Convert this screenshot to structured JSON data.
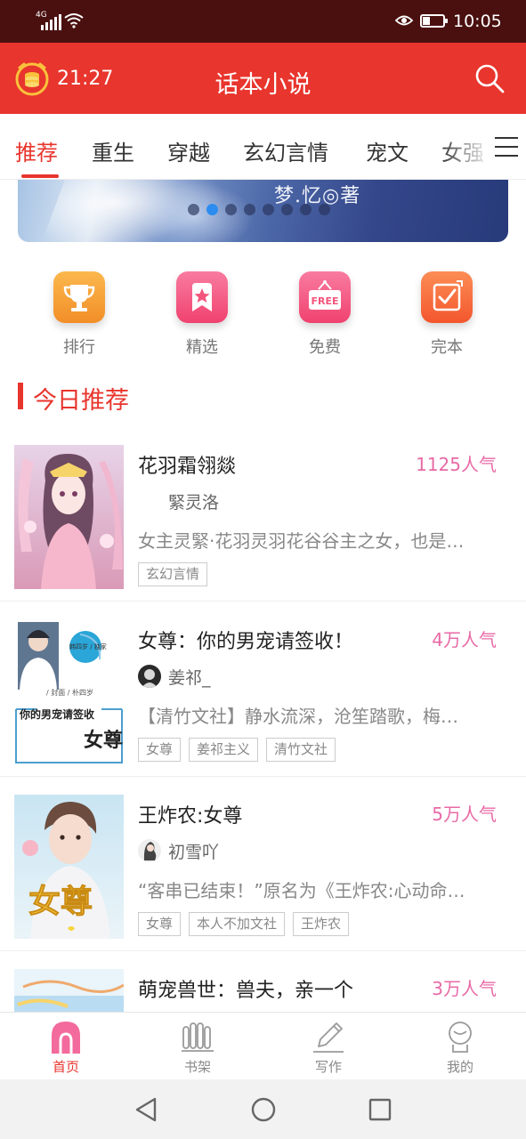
{
  "status_bar": {
    "network": "4G",
    "time": "10:05"
  },
  "header": {
    "timer": "21:27",
    "title": "话本小说",
    "icons": [
      "coin-timer-icon",
      "search-icon"
    ]
  },
  "tabs": [
    {
      "label": "推荐",
      "active": true
    },
    {
      "label": "重生",
      "active": false
    },
    {
      "label": "穿越",
      "active": false
    },
    {
      "label": "玄幻言情",
      "active": false
    },
    {
      "label": "宠文",
      "active": false
    },
    {
      "label": "女强",
      "active": false
    }
  ],
  "banner": {
    "caption": "梦.忆◎著",
    "slide_count": 8,
    "active_slide": 1
  },
  "quick_actions": [
    {
      "label": "排行",
      "icon": "trophy-icon",
      "color": "#f5a33a"
    },
    {
      "label": "精选",
      "icon": "star-icon",
      "color": "#f4547c"
    },
    {
      "label": "免费",
      "icon": "free-sign-icon",
      "color": "#f4547c",
      "icon_text": "FREE"
    },
    {
      "label": "完本",
      "icon": "check-icon",
      "color": "#f86a3c"
    }
  ],
  "section": {
    "title": "今日推荐"
  },
  "books": [
    {
      "title": "花羽霜翎燚",
      "popularity": "1125人气",
      "author": "緊灵洛",
      "description": "女主灵緊·花羽灵羽花谷谷主之女，也是…",
      "tags": [
        "玄幻言情"
      ]
    },
    {
      "title": "女尊：你的男宠请签收！",
      "popularity": "4万人气",
      "author": "姜祁_",
      "description": "【清竹文社】静水流深，沧笙踏歌，梅…",
      "tags": [
        "女尊",
        "姜祁主义",
        "清竹文社"
      ],
      "cover_text": {
        "line1": "娃谷",
        "line2": "韩四岁 / 独家",
        "line3": "/ 封面 / 朴四岁",
        "line4": "你的男宠请签收",
        "line5": "女尊"
      }
    },
    {
      "title": "王炸农:女尊",
      "popularity": "5万人气",
      "author": "初雪吖",
      "description": "“客串已结束！”原名为《王炸农:心动命…",
      "tags": [
        "女尊",
        "本人不加文社",
        "王炸农"
      ],
      "cover_text": {
        "line1": "女尊"
      }
    },
    {
      "title": "萌宠兽世：兽夫，亲一个",
      "popularity": "3万人气",
      "author": "",
      "description": "",
      "tags": []
    }
  ],
  "bottom_nav": [
    {
      "label": "首页",
      "icon": "home-icon",
      "active": true
    },
    {
      "label": "书架",
      "icon": "bookshelf-icon",
      "active": false
    },
    {
      "label": "写作",
      "icon": "pencil-icon",
      "active": false
    },
    {
      "label": "我的",
      "icon": "profile-icon",
      "active": false
    }
  ],
  "system_nav": [
    "back-icon",
    "home-circle-icon",
    "recents-icon"
  ],
  "colors": {
    "status_bar": "#4a1010",
    "accent": "#e8352d",
    "popularity": "#e86aa6"
  }
}
